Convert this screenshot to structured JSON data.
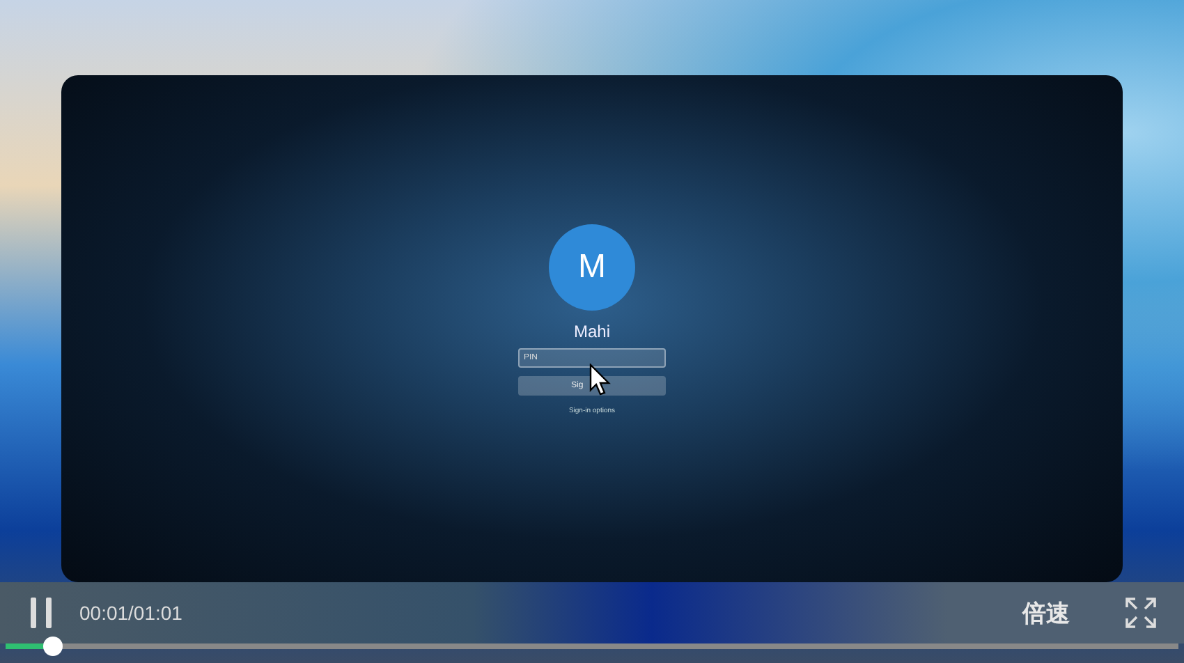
{
  "login_screen": {
    "avatar_letter": "M",
    "user_name": "Mahi",
    "pin_field": {
      "placeholder": "PIN"
    },
    "sign_in_button": "Sig",
    "sign_in_options_link": "Sign-in options"
  },
  "player_controls": {
    "playing": true,
    "time": "00:01/01:01",
    "speed_button": "倍速",
    "progress": {
      "level": 0.04
    }
  }
}
